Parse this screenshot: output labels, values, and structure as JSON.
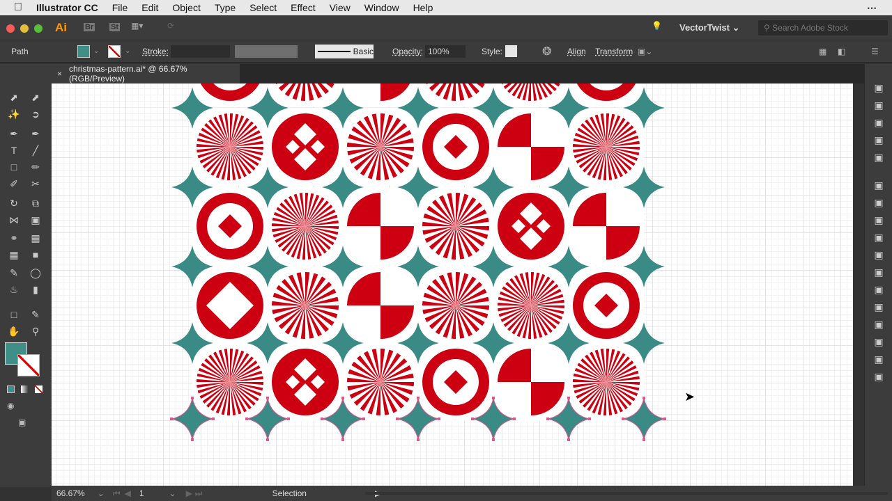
{
  "menubar": {
    "app": "Illustrator CC",
    "items": [
      "File",
      "Edit",
      "Object",
      "Type",
      "Select",
      "Effect",
      "View",
      "Window",
      "Help"
    ]
  },
  "appbar": {
    "logo": "Ai",
    "br": "Br",
    "st": "St",
    "workspace": "VectorTwist",
    "search_placeholder": "Search Adobe Stock"
  },
  "control": {
    "selection_type": "Path",
    "stroke_label": "Stroke:",
    "brush_label": "Basic",
    "opacity_label": "Opacity:",
    "opacity_value": "100%",
    "style_label": "Style:",
    "align": "Align",
    "transform": "Transform"
  },
  "document": {
    "tab_title": "christmas-pattern.ai* @ 66.67% (RGB/Preview)"
  },
  "status": {
    "zoom": "66.67%",
    "artboard": "1",
    "tool": "Selection"
  },
  "colors": {
    "red": "#cc0011",
    "teal": "#3a8b86",
    "fill": "#3f8f88"
  },
  "artwork": {
    "tile_rows": [
      [
        "B",
        "W",
        "Q",
        "W",
        "D",
        "B"
      ],
      [
        "D",
        "X",
        "W",
        "B",
        "Q",
        "D"
      ],
      [
        "B",
        "D",
        "Q",
        "W",
        "X",
        "Q"
      ],
      [
        "G",
        "W",
        "Q",
        "W",
        "D",
        "B"
      ],
      [
        "D",
        "X",
        "W",
        "B",
        "Q",
        "D"
      ]
    ]
  }
}
